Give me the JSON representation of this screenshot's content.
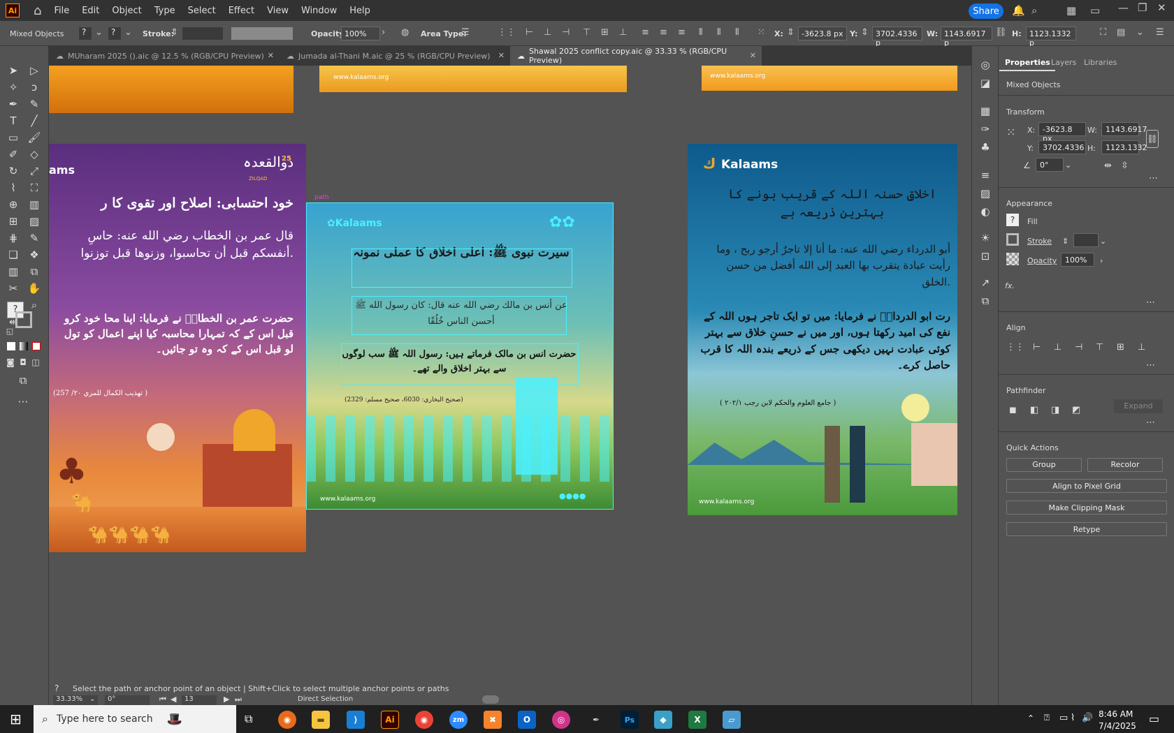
{
  "menubar": {
    "app_icon": "Ai",
    "items": [
      "File",
      "Edit",
      "Object",
      "Type",
      "Select",
      "Effect",
      "View",
      "Window",
      "Help"
    ],
    "share_label": "Share"
  },
  "control_bar": {
    "selection_label": "Mixed Objects",
    "stroke_label": "Stroke:",
    "opacity_label": "Opacity:",
    "opacity_value": "100%",
    "area_type_label": "Area Type:",
    "x_label": "X:",
    "x_value": "-3623.8 px",
    "y_label": "Y:",
    "y_value": "3702.4336 p",
    "w_label": "W:",
    "w_value": "1143.6917 p",
    "h_label": "H:",
    "h_value": "1123.1332 p"
  },
  "tabs": [
    {
      "label": "MUharam 2025 ().aic @ 12.5 % (RGB/CPU Preview)",
      "active": false
    },
    {
      "label": "Jumada al-Thani M.aic @ 25 % (RGB/CPU Preview)",
      "active": false
    },
    {
      "label": "Shawal 2025 conflict copy.aic @ 33.33 % (RGB/CPU Preview)",
      "active": true
    }
  ],
  "canvas": {
    "path_label": "path",
    "left_art": {
      "brand": "ams",
      "month": "ذوالقعدہ",
      "month_sub": "ZILQAD",
      "year": "25",
      "title": "خود احتسابی: اصلاح اور تقوی کا ر",
      "arabic": "قال عمر بن الخطاب رضي الله عنه: حاسِ أنفسكم قبل أن تحاسبوا، وزنوها قبل توزنوا.",
      "urdu": "حضرت عمر بن الخطابؓ نے فرمایا: اپنا محا خود کرو قبل اس کے کہ تمہارا محاسبہ کیا اپنے اعمال کو تول لو قبل اس کے کہ وہ تو جائیں۔",
      "reference": "(تهذيب الكمال للمزي ٢٠/ 257 )"
    },
    "center_art": {
      "title": "سیرت نبوی ﷺ: اعلی اخلاق کا عملی نمونہ",
      "arabic": "عن أنس بن مالك رضي الله عنه قال: كان رسول الله ﷺ أحسن الناس خُلُقًا",
      "urdu": "حضرت انس بن مالک فرماتے ہیں: رسول اللہ ﷺ سب لوگوں سے بہتر اخلاق والے تھے۔",
      "reference": "(صحيح البخاري: 6030، صحيح مسلم: 2329)",
      "website": "www.kalaams.org"
    },
    "right_art": {
      "brand": "Kalaams",
      "title": "اخلاقِ حسنہ اللہ کے قریب ہونے کا بہترین ذریعہ ہے",
      "arabic": "أبو الدرداء رضي الله عنه: ما أنا إلا تاجرٌ أرجو ربح ، وما رأيت عبادة يتقرب بها العبد إلى الله أفضل من حسن الخلق.",
      "urdu": "رت ابو الدرداءؓ نے فرمایا: میں تو ایک تاجر ہوں اللہ کے نفع کی امید رکھتا ہوں، اور میں نے حسنِ خلاق سے بہتر کوئی عبادت نہیں دیکھی جس کے ذریعے بندہ اللہ کا قرب حاصل کرے۔",
      "reference": "( جامع العلوم والحكم لابن رجب ٢٠٢/١ )",
      "website": "www.kalaams.org"
    },
    "top_art_website": "www.kalaams.org"
  },
  "properties": {
    "tabs": [
      "Properties",
      "Layers",
      "Libraries"
    ],
    "selection": "Mixed Objects",
    "transform_title": "Transform",
    "x_label": "X:",
    "x_value": "-3623.8 px",
    "y_label": "Y:",
    "y_value": "3702.4336",
    "w_label": "W:",
    "w_value": "1143.6917",
    "h_label": "H:",
    "h_value": "1123.1332",
    "angle_value": "0°",
    "appearance_title": "Appearance",
    "fill_label": "Fill",
    "stroke_label": "Stroke",
    "opacity_label": "Opacity",
    "opacity_value": "100%",
    "fx_label": "fx.",
    "align_title": "Align",
    "pathfinder_title": "Pathfinder",
    "expand_label": "Expand",
    "quick_actions_title": "Quick Actions",
    "group_label": "Group",
    "recolor_label": "Recolor",
    "align_pixel_label": "Align to Pixel Grid",
    "clipping_label": "Make Clipping Mask",
    "retype_label": "Retype"
  },
  "status": {
    "hint": "Select the path or anchor point of an object  |  Shift+Click to select multiple anchor points or paths",
    "zoom": "33.33%",
    "rotation": "0°",
    "artboard": "13",
    "tool": "Direct Selection"
  },
  "taskbar": {
    "search_placeholder": "Type here to search",
    "time": "8:46 AM",
    "date": "7/4/2025"
  },
  "colors": {
    "selection": "#4af0ff",
    "accent": "#1473e6",
    "left_art_top": "#5a2e7e",
    "left_art_bottom": "#e8883c",
    "right_art_top": "#0e5a8c"
  }
}
